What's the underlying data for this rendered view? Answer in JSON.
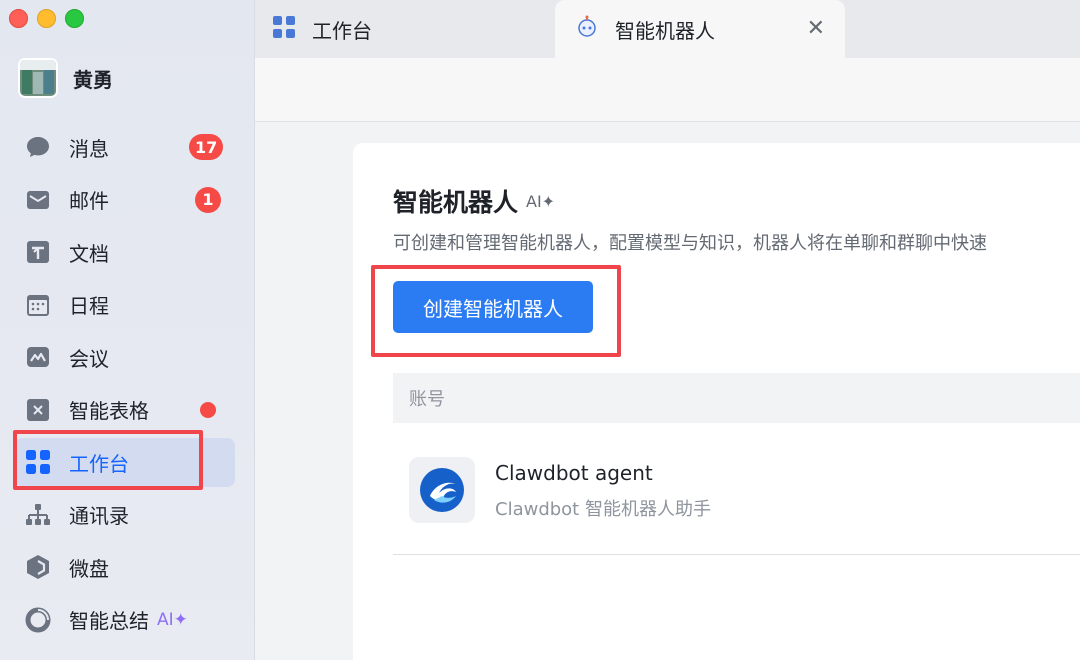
{
  "profile": {
    "name": "黄勇"
  },
  "sidebar": {
    "items": [
      {
        "label": "消息",
        "badge": "17"
      },
      {
        "label": "邮件",
        "badge": "1"
      },
      {
        "label": "文档"
      },
      {
        "label": "日程"
      },
      {
        "label": "会议"
      },
      {
        "label": "智能表格"
      },
      {
        "label": "工作台"
      },
      {
        "label": "通讯录"
      },
      {
        "label": "微盘"
      },
      {
        "label": "智能总结",
        "tag": "AI✦"
      }
    ]
  },
  "tabs": [
    {
      "label": "工作台"
    },
    {
      "label": "智能机器人",
      "close": "✕"
    }
  ],
  "page": {
    "title": "智能机器人",
    "title_tag": "AI✦",
    "description": "可创建和管理智能机器人，配置模型与知识，机器人将在单聊和群聊中快速",
    "create_button": "创建智能机器人",
    "table_header": "账号",
    "bots": [
      {
        "name": "Clawdbot agent",
        "subtitle": "Clawdbot 智能机器人助手"
      }
    ]
  },
  "colors": {
    "accent": "#1664ff",
    "primary_button": "#2b7cf2",
    "badge": "#f54a45",
    "highlight": "#f0454a"
  }
}
